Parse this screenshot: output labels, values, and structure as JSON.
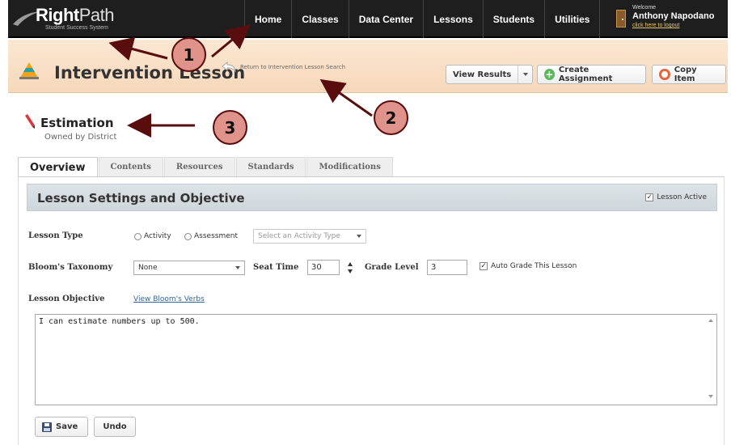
{
  "brand": {
    "name_bold": "Right",
    "name_light": "Path",
    "tagline": "Student Success System"
  },
  "nav": {
    "items": [
      "Home",
      "Classes",
      "Data Center",
      "Lessons",
      "Students",
      "Utilities"
    ]
  },
  "user": {
    "welcome": "Welcome",
    "name": "Anthony Napodano",
    "logout": "click here to logout"
  },
  "page": {
    "title": "Intervention Lesson",
    "return_link": "Return to Intervention Lesson Search"
  },
  "actions": {
    "view_results": "View Results",
    "create_assignment": "Create Assignment",
    "copy_item": "Copy Item"
  },
  "lesson": {
    "name": "Estimation",
    "owner": "Owned by District"
  },
  "tabs": [
    {
      "label": "Overview",
      "active": true
    },
    {
      "label": "Contents"
    },
    {
      "label": "Resources"
    },
    {
      "label": "Standards"
    },
    {
      "label": "Modifications"
    }
  ],
  "settings": {
    "title": "Lesson Settings and Objective",
    "lesson_active_label": "Lesson Active",
    "lesson_active_checked": true,
    "lesson_type_label": "Lesson Type",
    "radio_activity": "Activity",
    "radio_assessment": "Assessment",
    "activity_type_placeholder": "Select an Activity Type",
    "bloom_label": "Bloom's Taxonomy",
    "bloom_value": "None",
    "seat_time_label": "Seat Time",
    "seat_time_value": "30",
    "grade_level_label": "Grade Level",
    "grade_level_value": "3",
    "auto_grade_label": "Auto Grade This Lesson",
    "auto_grade_checked": true,
    "objective_label": "Lesson Objective",
    "bloom_verbs_link": "View Bloom's Verbs",
    "objective_text": "I can estimate numbers up to 500."
  },
  "footer": {
    "save": "Save",
    "undo": "Undo"
  },
  "callouts": [
    "1",
    "2",
    "3"
  ],
  "colors": {
    "callout_fill": "#e0938a",
    "callout_border": "#5a0d0d",
    "arrow": "#5a0d0d",
    "nav_bg": "#1e1e1e",
    "band_bg": "#f8dfc5"
  }
}
